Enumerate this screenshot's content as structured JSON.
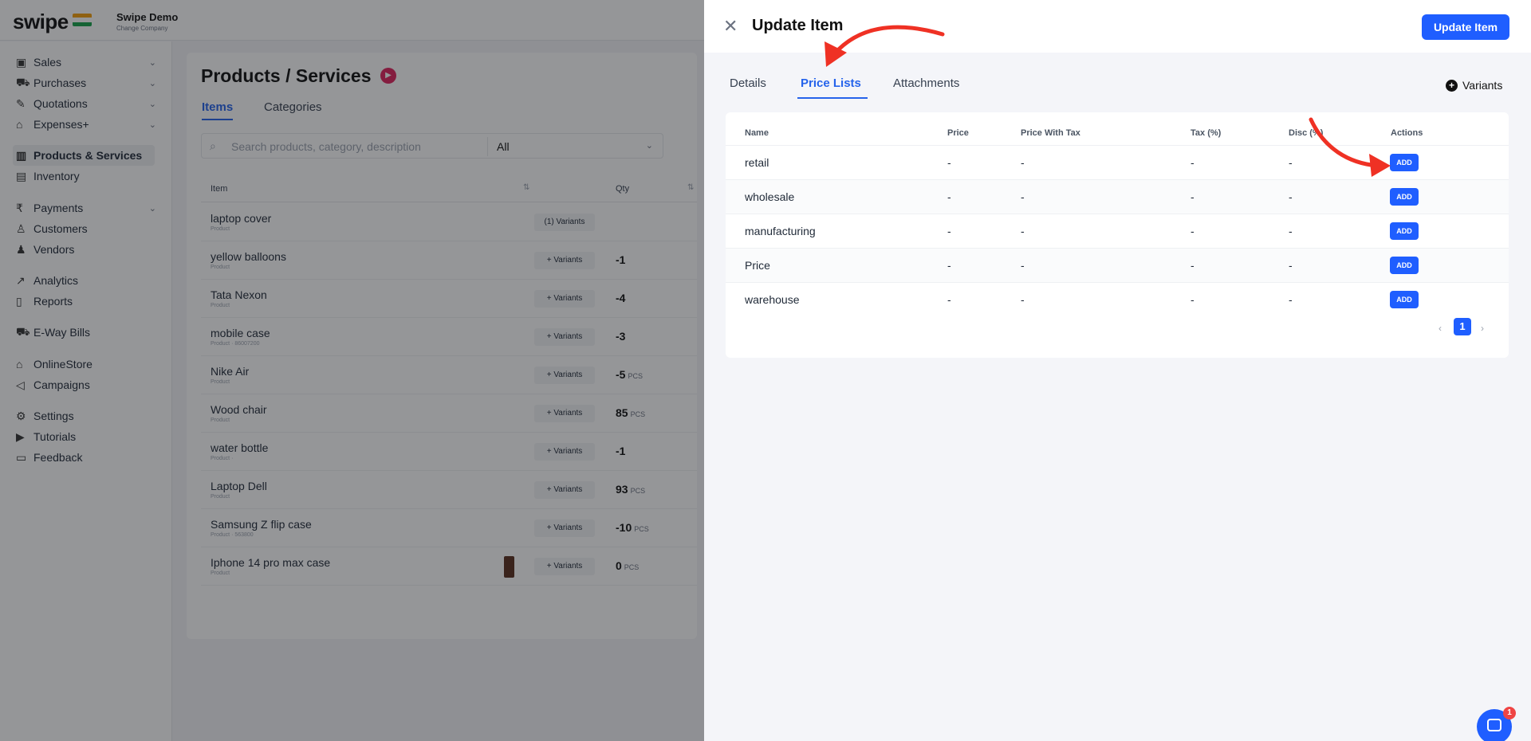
{
  "brand": {
    "logo": "swipe",
    "company_name": "Swipe Demo",
    "company_sub": "Change Company"
  },
  "sidebar": {
    "items": [
      {
        "label": "Sales",
        "icon": "sales-icon",
        "glyph": "▣",
        "chevron": "⌄"
      },
      {
        "label": "Purchases",
        "icon": "cart-icon",
        "glyph": "⛟",
        "chevron": "⌄"
      },
      {
        "label": "Quotations",
        "icon": "pen-icon",
        "glyph": "✎",
        "chevron": "⌄"
      },
      {
        "label": "Expenses+",
        "icon": "tag-icon",
        "glyph": "⌂",
        "chevron": "⌄"
      },
      {
        "label": "Products & Services",
        "icon": "barcode-icon",
        "glyph": "▥",
        "chevron": ""
      },
      {
        "label": "Inventory",
        "icon": "inventory-icon",
        "glyph": "▤",
        "chevron": ""
      },
      {
        "label": "Payments",
        "icon": "rupee-icon",
        "glyph": "₹",
        "chevron": "⌄"
      },
      {
        "label": "Customers",
        "icon": "user-icon",
        "glyph": "♙",
        "chevron": ""
      },
      {
        "label": "Vendors",
        "icon": "users-icon",
        "glyph": "♟",
        "chevron": ""
      },
      {
        "label": "Analytics",
        "icon": "chart-icon",
        "glyph": "↗",
        "chevron": ""
      },
      {
        "label": "Reports",
        "icon": "report-icon",
        "glyph": "▯",
        "chevron": ""
      },
      {
        "label": "E-Way Bills",
        "icon": "truck-icon",
        "glyph": "⛟",
        "chevron": ""
      },
      {
        "label": "OnlineStore",
        "icon": "store-icon",
        "glyph": "⌂",
        "chevron": ""
      },
      {
        "label": "Campaigns",
        "icon": "megaphone-icon",
        "glyph": "◁",
        "chevron": ""
      },
      {
        "label": "Settings",
        "icon": "gear-icon",
        "glyph": "⚙",
        "chevron": ""
      },
      {
        "label": "Tutorials",
        "icon": "youtube-icon",
        "glyph": "▶",
        "chevron": ""
      },
      {
        "label": "Feedback",
        "icon": "message-icon",
        "glyph": "▭",
        "chevron": ""
      }
    ]
  },
  "products_page": {
    "title": "Products / Services",
    "tabs": [
      "Items",
      "Categories"
    ],
    "search_placeholder": "Search products, category, description",
    "filter_value": "All",
    "columns": [
      "Item",
      "Qty"
    ],
    "rows": [
      {
        "name": "laptop cover",
        "type": "Product",
        "variants": "(1) Variants",
        "qty": "",
        "unit": ""
      },
      {
        "name": "yellow balloons",
        "type": "Product",
        "variants": "+ Variants",
        "qty": "-1",
        "unit": ""
      },
      {
        "name": "Tata Nexon",
        "type": "Product",
        "variants": "+ Variants",
        "qty": "-4",
        "unit": ""
      },
      {
        "name": "mobile case",
        "type": "Product · 86007200",
        "variants": "+ Variants",
        "qty": "-3",
        "unit": ""
      },
      {
        "name": "Nike Air",
        "type": "Product",
        "variants": "+ Variants",
        "qty": "-5",
        "unit": "PCS"
      },
      {
        "name": "Wood chair",
        "type": "Product",
        "variants": "+ Variants",
        "qty": "85",
        "unit": "PCS"
      },
      {
        "name": "water bottle",
        "type": "Product ·",
        "variants": "+ Variants",
        "qty": "-1",
        "unit": ""
      },
      {
        "name": "Laptop Dell",
        "type": "Product",
        "variants": "+ Variants",
        "qty": "93",
        "unit": "PCS"
      },
      {
        "name": "Samsung Z flip case",
        "type": "Product · 563800",
        "variants": "+ Variants",
        "qty": "-10",
        "unit": "PCS"
      },
      {
        "name": "Iphone 14 pro max case",
        "type": "Product",
        "variants": "+ Variants",
        "qty": "0",
        "unit": "PCS"
      }
    ]
  },
  "drawer": {
    "title": "Update Item",
    "update_button": "Update Item",
    "tabs": [
      "Details",
      "Price Lists",
      "Attachments"
    ],
    "variants_link": "Variants",
    "columns": [
      "Name",
      "Price",
      "Price With Tax",
      "Tax (%)",
      "Disc (%)",
      "Actions"
    ],
    "rows": [
      {
        "name": "retail",
        "price": "-",
        "price_with_tax": "-",
        "tax": "-",
        "disc": "-",
        "action": "ADD"
      },
      {
        "name": "wholesale",
        "price": "-",
        "price_with_tax": "-",
        "tax": "-",
        "disc": "-",
        "action": "ADD"
      },
      {
        "name": "manufacturing",
        "price": "-",
        "price_with_tax": "-",
        "tax": "-",
        "disc": "-",
        "action": "ADD"
      },
      {
        "name": "Price",
        "price": "-",
        "price_with_tax": "-",
        "tax": "-",
        "disc": "-",
        "action": "ADD"
      },
      {
        "name": "warehouse",
        "price": "-",
        "price_with_tax": "-",
        "tax": "-",
        "disc": "-",
        "action": "ADD"
      }
    ],
    "pagination": {
      "current_page": "1"
    }
  },
  "chat": {
    "badge": "1"
  },
  "colors": {
    "accent": "#1f5eff",
    "annotation_arrow": "#ef3124",
    "play_badge": "#e0245e"
  }
}
